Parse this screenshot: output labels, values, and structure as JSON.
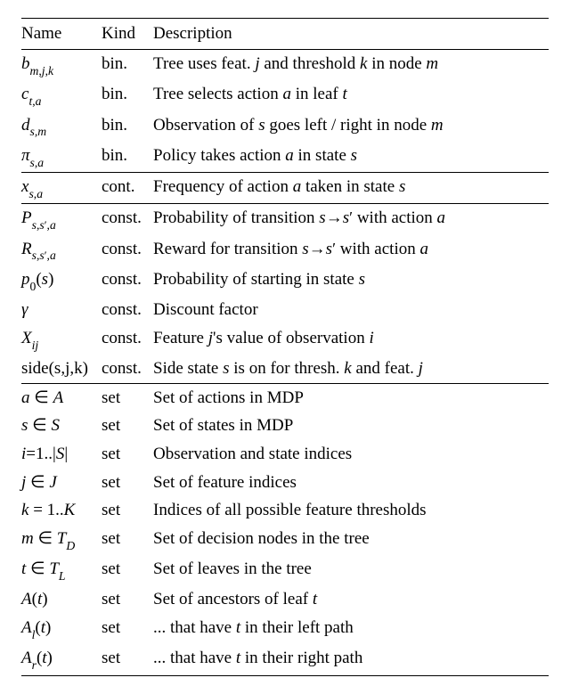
{
  "headers": {
    "name": "Name",
    "kind": "Kind",
    "desc": "Description"
  },
  "rows": [
    {
      "name_html": "<span class='it'>b</span><span class='sub'><span class='it'>m</span>,<span class='it'>j</span>,<span class='it'>k</span></span>",
      "kind": "bin.",
      "desc_html": "Tree uses feat. <span class='it'>j</span> and threshold <span class='it'>k</span> in node <span class='it'>m</span>",
      "section_end": false
    },
    {
      "name_html": "<span class='it'>c</span><span class='sub'><span class='it'>t</span>,<span class='it'>a</span></span>",
      "kind": "bin.",
      "desc_html": "Tree selects action <span class='it'>a</span> in leaf <span class='it'>t</span>",
      "section_end": false
    },
    {
      "name_html": "<span class='it'>d</span><span class='sub'><span class='it'>s</span>,<span class='it'>m</span></span>",
      "kind": "bin.",
      "desc_html": "Observation of <span class='it'>s</span> goes left / right in node <span class='it'>m</span>",
      "section_end": false
    },
    {
      "name_html": "<span class='it'>π</span><span class='sub'><span class='it'>s</span>,<span class='it'>a</span></span>",
      "kind": "bin.",
      "desc_html": "Policy takes action <span class='it'>a</span> in state <span class='it'>s</span>",
      "section_end": true
    },
    {
      "name_html": "<span class='it'>x</span><span class='sub'><span class='it'>s</span>,<span class='it'>a</span></span>",
      "kind": "cont.",
      "desc_html": "Frequency of action <span class='it'>a</span> taken in state <span class='it'>s</span>",
      "section_end": true
    },
    {
      "name_html": "<span class='it'>P</span><span class='sub'><span class='it'>s</span>,<span class='it'>s</span><span class='prime'>′</span>,<span class='it'>a</span></span>",
      "kind": "const.",
      "desc_html": "Probability of transition <span class='it'>s</span>→<span class='it'>s</span><span class='prime'>′</span> with action <span class='it'>a</span>",
      "section_end": false
    },
    {
      "name_html": "<span class='it'>R</span><span class='sub'><span class='it'>s</span>,<span class='it'>s</span><span class='prime'>′</span>,<span class='it'>a</span></span>",
      "kind": "const.",
      "desc_html": "Reward for transition <span class='it'>s</span>→<span class='it'>s</span><span class='prime'>′</span> with action <span class='it'>a</span>",
      "section_end": false
    },
    {
      "name_html": "<span class='it'>p</span><span class='sub'>0</span>(<span class='it'>s</span>)",
      "kind": "const.",
      "desc_html": "Probability of starting in state <span class='it'>s</span>",
      "section_end": false
    },
    {
      "name_html": "<span class='it'>γ</span>",
      "kind": "const.",
      "desc_html": "Discount factor",
      "section_end": false
    },
    {
      "name_html": "<span class='it'>X</span><span class='sub'><span class='it'>ij</span></span>",
      "kind": "const.",
      "desc_html": "Feature <span class='it'>j</span>'s value of observation <span class='it'>i</span>",
      "section_end": false
    },
    {
      "name_html": "side(s,j,k)",
      "kind": "const.",
      "desc_html": "Side state <span class='it'>s</span> is on for thresh. <span class='it'>k</span> and feat. <span class='it'>j</span>",
      "section_end": true
    },
    {
      "name_html": "<span class='it'>a</span> ∈ <span class='it'>A</span>",
      "kind": "set",
      "desc_html": "Set of actions in MDP",
      "section_end": false
    },
    {
      "name_html": "<span class='it'>s</span> ∈ <span class='it'>S</span>",
      "kind": "set",
      "desc_html": "Set of states in MDP",
      "section_end": false
    },
    {
      "name_html": "<span class='it'>i</span>=1..|<span class='it'>S</span>|",
      "kind": "set",
      "desc_html": "Observation and state indices",
      "section_end": false
    },
    {
      "name_html": "<span class='it'>j</span> ∈ <span class='it'>J</span>",
      "kind": "set",
      "desc_html": "Set of feature indices",
      "section_end": false
    },
    {
      "name_html": "<span class='it'>k</span> = 1..<span class='it'>K</span>",
      "kind": "set",
      "desc_html": "Indices of all possible feature thresholds",
      "section_end": false
    },
    {
      "name_html": "<span class='it'>m</span> ∈ <span class='cal'>T</span><span class='sub'><span class='it'>D</span></span>",
      "kind": "set",
      "desc_html": "Set of decision nodes in the tree",
      "section_end": false
    },
    {
      "name_html": "<span class='it'>t</span> ∈ <span class='cal'>T</span><span class='sub'><span class='it'>L</span></span>",
      "kind": "set",
      "desc_html": "Set of leaves in the tree",
      "section_end": false
    },
    {
      "name_html": "<span class='it'>A</span>(<span class='it'>t</span>)",
      "kind": "set",
      "desc_html": "Set of ancestors of leaf <span class='it'>t</span>",
      "section_end": false
    },
    {
      "name_html": "<span class='it'>A</span><span class='sub'><span class='it'>l</span></span>(<span class='it'>t</span>)",
      "kind": "set",
      "desc_html": "... that have <span class='it'>t</span> in their left path",
      "section_end": false
    },
    {
      "name_html": "<span class='it'>A</span><span class='sub'><span class='it'>r</span></span>(<span class='it'>t</span>)",
      "kind": "set",
      "desc_html": "... that have <span class='it'>t</span> in their right path",
      "section_end": false,
      "last_row": true
    }
  ],
  "chart_data": {
    "type": "table",
    "headers": [
      "Name",
      "Kind",
      "Description"
    ],
    "sections": [
      {
        "rows": [
          [
            "b_{m,j,k}",
            "bin.",
            "Tree uses feat. j and threshold k in node m"
          ],
          [
            "c_{t,a}",
            "bin.",
            "Tree selects action a in leaf t"
          ],
          [
            "d_{s,m}",
            "bin.",
            "Observation of s goes left / right in node m"
          ],
          [
            "π_{s,a}",
            "bin.",
            "Policy takes action a in state s"
          ]
        ]
      },
      {
        "rows": [
          [
            "x_{s,a}",
            "cont.",
            "Frequency of action a taken in state s"
          ]
        ]
      },
      {
        "rows": [
          [
            "P_{s,s',a}",
            "const.",
            "Probability of transition s→s' with action a"
          ],
          [
            "R_{s,s',a}",
            "const.",
            "Reward for transition s→s' with action a"
          ],
          [
            "p_0(s)",
            "const.",
            "Probability of starting in state s"
          ],
          [
            "γ",
            "const.",
            "Discount factor"
          ],
          [
            "X_{ij}",
            "const.",
            "Feature j's value of observation i"
          ],
          [
            "side(s,j,k)",
            "const.",
            "Side state s is on for thresh. k and feat. j"
          ]
        ]
      },
      {
        "rows": [
          [
            "a ∈ A",
            "set",
            "Set of actions in MDP"
          ],
          [
            "s ∈ S",
            "set",
            "Set of states in MDP"
          ],
          [
            "i=1..|S|",
            "set",
            "Observation and state indices"
          ],
          [
            "j ∈ J",
            "set",
            "Set of feature indices"
          ],
          [
            "k = 1..K",
            "set",
            "Indices of all possible feature thresholds"
          ],
          [
            "m ∈ T_D",
            "set",
            "Set of decision nodes in the tree"
          ],
          [
            "t ∈ T_L",
            "set",
            "Set of leaves in the tree"
          ],
          [
            "A(t)",
            "set",
            "Set of ancestors of leaf t"
          ],
          [
            "A_l(t)",
            "set",
            "... that have t in their left path"
          ],
          [
            "A_r(t)",
            "set",
            "... that have t in their right path"
          ]
        ]
      }
    ]
  }
}
